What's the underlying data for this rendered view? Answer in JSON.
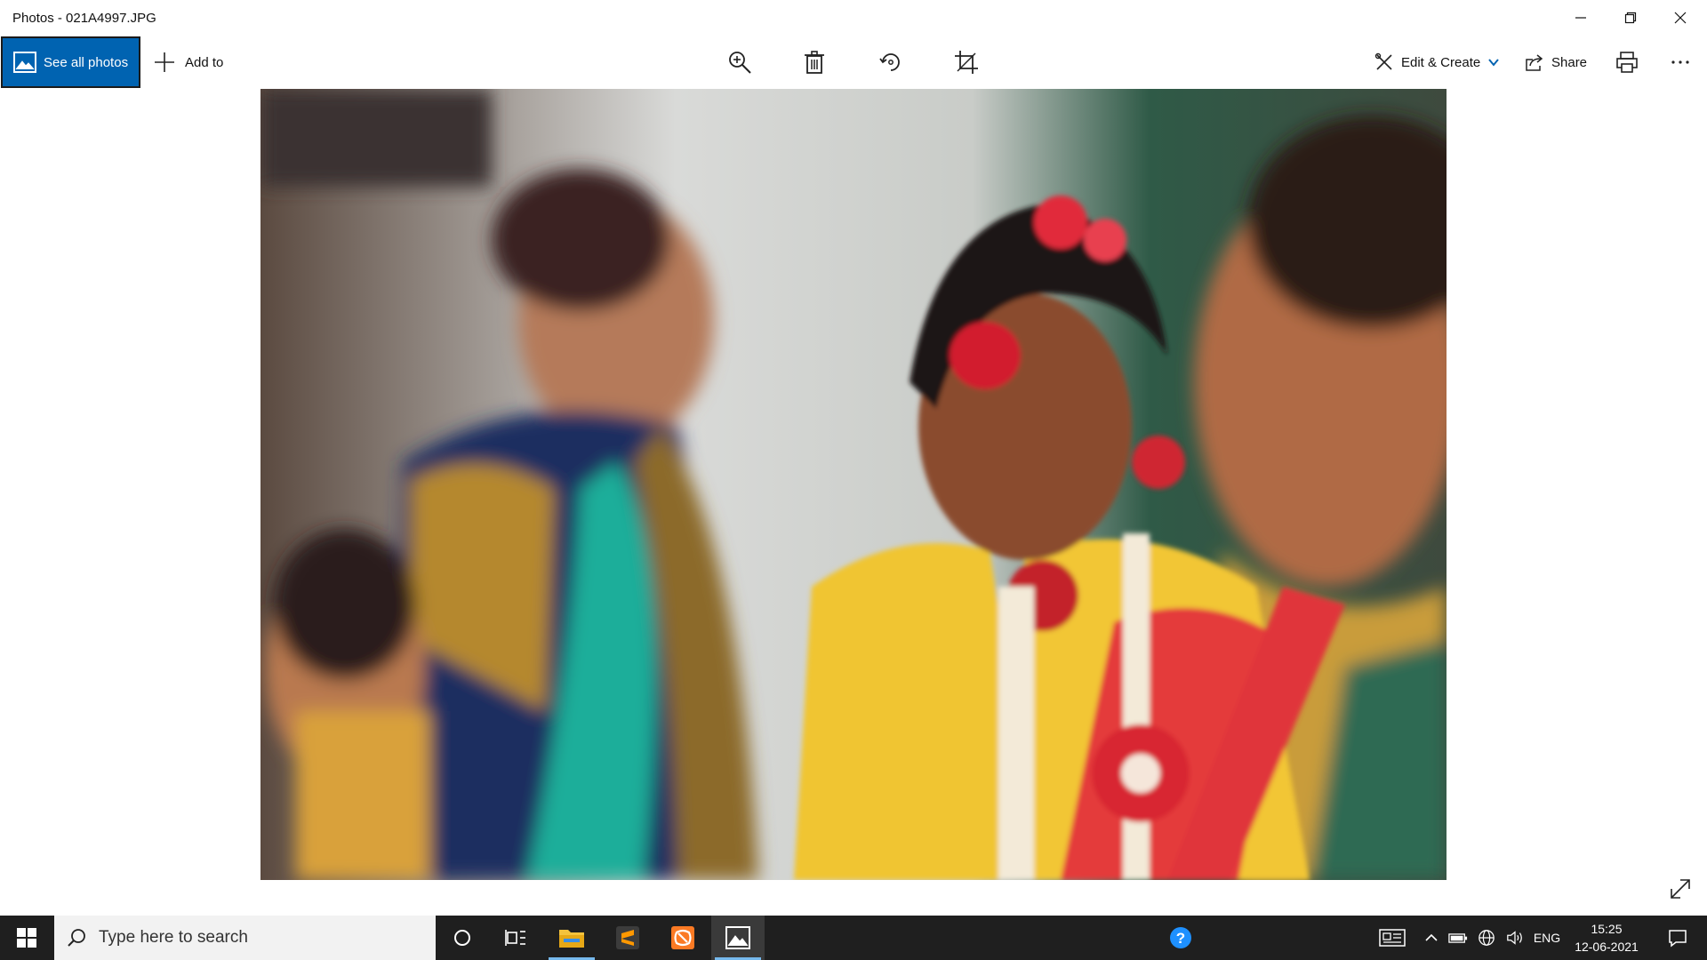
{
  "window": {
    "title": "Photos - 021A4997.JPG"
  },
  "toolbar": {
    "see_all_photos": "See all photos",
    "add_to": "Add to",
    "edit_create": "Edit & Create",
    "share": "Share",
    "more": "..."
  },
  "photo": {
    "description_icon": "photo-image"
  },
  "taskbar": {
    "search_placeholder": "Type here to search",
    "language": "ENG",
    "time": "15:25",
    "date": "12-06-2021"
  },
  "colors": {
    "accent": "#0063b1",
    "taskbar": "#1f1f1f",
    "active_indicator": "#76b9ed"
  }
}
